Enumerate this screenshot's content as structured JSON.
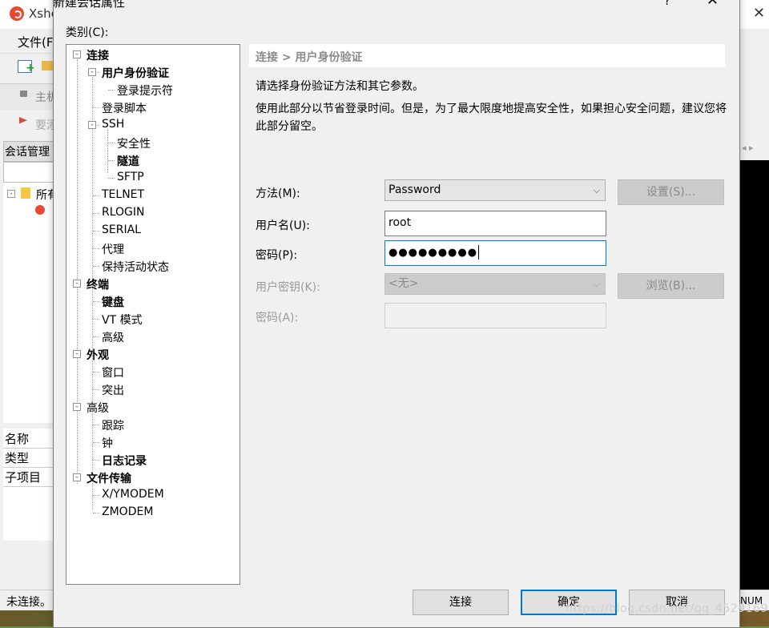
{
  "background_app": {
    "title": "Xshe",
    "menu_file": "文件(F",
    "address_placeholder": "主机",
    "hint_text": "要添",
    "session_panel_title": "会话管理",
    "tree_root": "所有",
    "tree_box": "-",
    "props": [
      "名称",
      "类型",
      "子项目"
    ],
    "status": "未连接。",
    "num_indicator": "NUM",
    "right_tab_arrows": "◂ ▸",
    "watermark": "https://blog.csdn.net/qq_45291692",
    "close_glyph": "✕"
  },
  "dialog": {
    "title": "新建会话属性",
    "help_glyph": "?",
    "close_glyph": "✕",
    "category_label": "类别(C):",
    "tree": [
      {
        "label": "连接",
        "bold": true,
        "expander": "-"
      },
      {
        "label": "用户身份验证",
        "bold": true,
        "expander": "-"
      },
      {
        "label": "登录提示符",
        "bold": false
      },
      {
        "label": "登录脚本",
        "bold": false
      },
      {
        "label": "SSH",
        "bold": false,
        "expander": "-"
      },
      {
        "label": "安全性",
        "bold": false
      },
      {
        "label": "隧道",
        "bold": true
      },
      {
        "label": "SFTP",
        "bold": false
      },
      {
        "label": "TELNET",
        "bold": false
      },
      {
        "label": "RLOGIN",
        "bold": false
      },
      {
        "label": "SERIAL",
        "bold": false
      },
      {
        "label": "代理",
        "bold": false
      },
      {
        "label": "保持活动状态",
        "bold": false
      },
      {
        "label": "终端",
        "bold": true,
        "expander": "-"
      },
      {
        "label": "键盘",
        "bold": true
      },
      {
        "label": "VT 模式",
        "bold": false
      },
      {
        "label": "高级",
        "bold": false
      },
      {
        "label": "外观",
        "bold": true,
        "expander": "-"
      },
      {
        "label": "窗口",
        "bold": false
      },
      {
        "label": "突出",
        "bold": false
      },
      {
        "label": "高级",
        "bold": false,
        "expander": "-"
      },
      {
        "label": "跟踪",
        "bold": false
      },
      {
        "label": "钟",
        "bold": false
      },
      {
        "label": "日志记录",
        "bold": true
      },
      {
        "label": "文件传输",
        "bold": true,
        "expander": "-"
      },
      {
        "label": "X/YMODEM",
        "bold": false
      },
      {
        "label": "ZMODEM",
        "bold": false
      }
    ],
    "header": "连接 > 用户身份验证",
    "desc1": "请选择身份验证方法和其它参数。",
    "desc2": "使用此部分以节省登录时间。但是，为了最大限度地提高安全性，如果担心安全问题，建议您将此部分留空。",
    "form": {
      "method_label": "方法(M):",
      "method_value": "Password",
      "settings_button": "设置(S)...",
      "username_label": "用户名(U):",
      "username_value": "root",
      "password_label": "密码(P):",
      "password_value": "●●●●●●●●●",
      "userkey_label": "用户密钥(K):",
      "userkey_value": "<无>",
      "browse_button": "浏览(B)...",
      "passphrase_label": "密码(A):",
      "passphrase_value": "",
      "chevron": "⌵"
    },
    "buttons": {
      "connect": "连接",
      "ok": "确定",
      "cancel": "取消"
    }
  }
}
